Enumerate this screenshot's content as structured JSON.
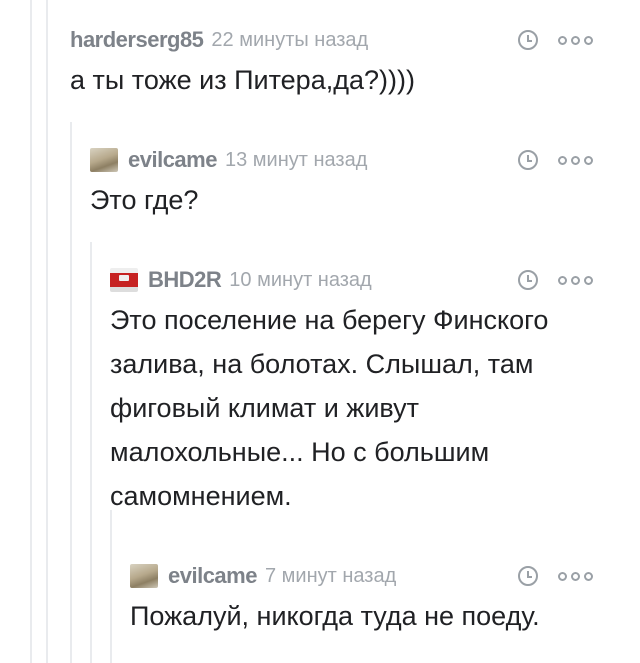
{
  "comments": [
    {
      "username": "harderserg85",
      "time": "22 минуты назад",
      "text": "а ты тоже из Питера,да?))))",
      "has_avatar": false
    },
    {
      "username": "evilcame",
      "time": "13 минут назад",
      "text": "Это где?",
      "has_avatar": true,
      "avatar_icon": "user-avatar-icon"
    },
    {
      "username": "BHD2R",
      "time": "10 минут назад",
      "text": "Это поселение на берегу Финского залива, на болотах. Слышал, там фиговый климат и живут малохольные... Но с большим самомнением.",
      "has_avatar": true,
      "avatar_icon": "user-avatar-icon"
    },
    {
      "username": "evilcame",
      "time": "7 минут назад",
      "text": "Пожалуй, никогда туда не поеду.",
      "has_avatar": true,
      "avatar_icon": "user-avatar-icon"
    }
  ],
  "icons": {
    "time": "clock-icon",
    "more": "more-options-icon"
  },
  "colors": {
    "username": "#7d8289",
    "time": "#a2a7ad",
    "text": "#202124",
    "thread_line": "#e9ebee",
    "icon": "#9aa0a6"
  }
}
